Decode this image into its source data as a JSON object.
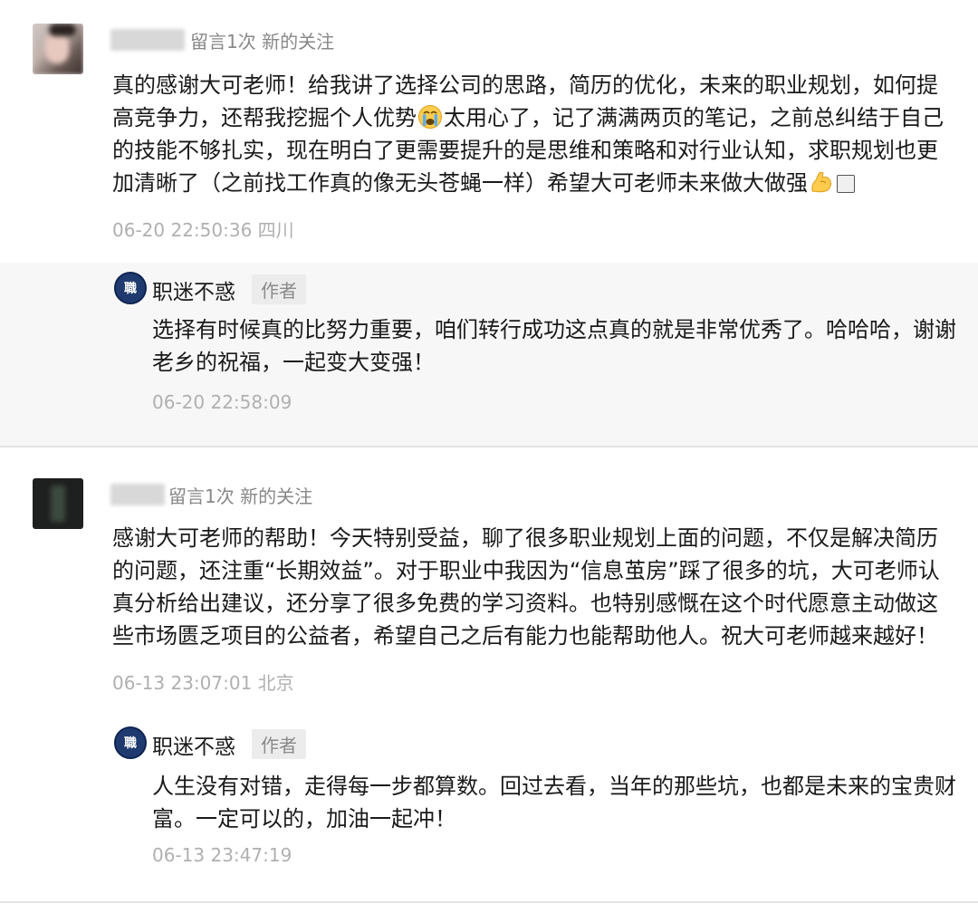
{
  "comments": [
    {
      "meta": "留言1次 新的关注",
      "text_parts": [
        "真的感谢大可老师！给我讲了选择公司的思路，简历的优化，未来的职业规划，如何提高竞争力，还帮我挖掘个人优势",
        "太用心了，记了满满两页的笔记，之前总纠结于自己的技能不够扎实，现在明白了更需要提升的是思维和策略和对行业认知，求职规划也更加清晰了（之前找工作真的像无头苍蝇一样）希望大可老师未来做大做强"
      ],
      "emojis": [
        "crying-face-emoji",
        "flexed-biceps-emoji",
        "unknown-glyph-box"
      ],
      "time": "06-20 22:50:36 四川",
      "reply": {
        "author": "职迷不惑",
        "badge": "作者",
        "text": "选择有时候真的比努力重要，咱们转行成功这点真的就是非常优秀了。哈哈哈，谢谢老乡的祝福，一起变大变强！",
        "time": "06-20 22:58:09"
      }
    },
    {
      "meta": "留言1次 新的关注",
      "text": "感谢大可老师的帮助！今天特别受益，聊了很多职业规划上面的问题，不仅是解决简历的问题，还注重“长期效益”。对于职业中我因为“信息茧房”踩了很多的坑，大可老师认真分析给出建议，还分享了很多免费的学习资料。也特别感慨在这个时代愿意主动做这些市场匮乏项目的公益者，希望自己之后有能力也能帮助他人。祝大可老师越来越好！",
      "time": "06-13 23:07:01 北京",
      "reply": {
        "author": "职迷不惑",
        "badge": "作者",
        "text": "人生没有对错，走得每一步都算数。回过去看，当年的那些坑，也都是未来的宝贵财富。一定可以的，加油一起冲！",
        "time": "06-13 23:47:19"
      }
    }
  ],
  "colors": {
    "reply_bg": "#f7f7f7",
    "meta_text": "#888888",
    "time_text": "#b0b0b0",
    "author_avatar": "#1f3a6e"
  }
}
